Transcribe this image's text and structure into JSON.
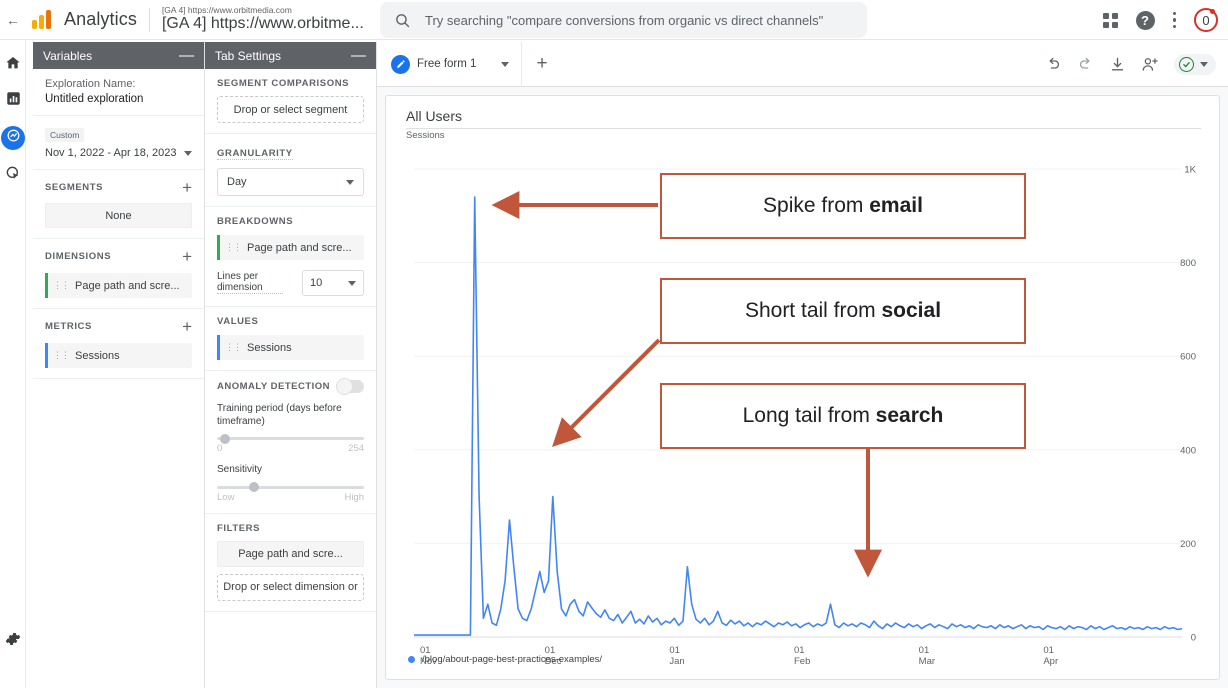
{
  "header": {
    "back_icon": "back-arrow-icon",
    "brand": "Analytics",
    "property_sub": "[GA 4] https://www.orbitmedia.com",
    "property_main": "[GA 4] https://www.orbitme...",
    "search_placeholder": "Try searching \"compare conversions from organic vs direct channels\"",
    "search_value": "",
    "apps_icon": "apps-grid-icon",
    "help_icon": "help-icon",
    "more_icon": "more-vertical-icon",
    "avatar_label": "0"
  },
  "rail": {
    "items": [
      {
        "name": "home-icon",
        "label": "Home"
      },
      {
        "name": "reports-icon",
        "label": "Reports"
      },
      {
        "name": "explore-icon",
        "label": "Explore"
      },
      {
        "name": "advertising-icon",
        "label": "Advertising"
      }
    ],
    "settings": {
      "name": "gear-icon",
      "label": "Admin"
    }
  },
  "variables": {
    "title": "Variables",
    "collapse": "—",
    "exploration_label": "Exploration Name:",
    "exploration_value": "Untitled exploration",
    "date_chip": "Custom",
    "date_range": "Nov 1, 2022 - Apr 18, 2023",
    "segments_label": "SEGMENTS",
    "segments_value": "None",
    "dimensions_label": "DIMENSIONS",
    "dimensions_value": "Page path and scre...",
    "metrics_label": "METRICS",
    "metrics_value": "Sessions",
    "add_label": "+"
  },
  "tab_settings": {
    "title": "Tab Settings",
    "collapse": "—",
    "segment_comparisons_label": "SEGMENT COMPARISONS",
    "segment_comparisons_value": "Drop or select segment",
    "granularity_label": "GRANULARITY",
    "granularity_value": "Day",
    "breakdowns_label": "BREAKDOWNS",
    "breakdowns_value": "Page path and scre...",
    "lines_per_label": "Lines per dimension",
    "lines_per_value": "10",
    "values_label": "VALUES",
    "values_value": "Sessions",
    "anomaly_label": "ANOMALY DETECTION",
    "anomaly_toggle": "off",
    "training_label": "Training period (days before timeframe)",
    "training_min": "0",
    "training_max": "254",
    "sensitivity_label": "Sensitivity",
    "sensitivity_min": "Low",
    "sensitivity_max": "High",
    "filters_label": "FILTERS",
    "filters_value": "Page path and scre...",
    "filters_drop": "Drop or select dimension or"
  },
  "canvas": {
    "tab_label": "Free form 1",
    "tab_icon": "pencil-icon",
    "tab_caret": "caret-down-icon",
    "add_tab": "+",
    "tools": [
      {
        "name": "undo-icon",
        "label": "Undo"
      },
      {
        "name": "redo-icon",
        "label": "Redo"
      },
      {
        "name": "download-icon",
        "label": "Download"
      },
      {
        "name": "share-add-user-icon",
        "label": "Share"
      }
    ],
    "status_icon": "check-circle-icon",
    "status_caret": "caret-down-icon"
  },
  "chart_data": {
    "type": "line",
    "title": "All Users",
    "subtitle": "Sessions",
    "xlabel": "",
    "ylabel": "Sessions",
    "ylim": [
      0,
      1000
    ],
    "y_ticks": [
      "0",
      "200",
      "400",
      "600",
      "800",
      "1K"
    ],
    "y_tick_values": [
      0,
      200,
      400,
      600,
      800,
      1000
    ],
    "x_ticks": [
      {
        "day": "01",
        "month": "Nov"
      },
      {
        "day": "01",
        "month": "Dec"
      },
      {
        "day": "01",
        "month": "Jan"
      },
      {
        "day": "01",
        "month": "Feb"
      },
      {
        "day": "01",
        "month": "Mar"
      },
      {
        "day": "01",
        "month": "Apr"
      }
    ],
    "grid": true,
    "legend_position": "bottom-left",
    "series": [
      {
        "name": "/blog/about-page-best-practices-examples/",
        "color": "#4285f4",
        "values": [
          4,
          4,
          4,
          4,
          4,
          4,
          4,
          4,
          4,
          4,
          4,
          4,
          4,
          4,
          940,
          300,
          40,
          70,
          30,
          25,
          60,
          120,
          250,
          150,
          60,
          40,
          35,
          60,
          100,
          140,
          95,
          120,
          300,
          140,
          60,
          45,
          70,
          80,
          55,
          45,
          75,
          62,
          50,
          42,
          58,
          40,
          35,
          48,
          30,
          42,
          55,
          30,
          38,
          28,
          45,
          32,
          40,
          26,
          34,
          30,
          40,
          25,
          34,
          150,
          70,
          38,
          30,
          40,
          26,
          34,
          55,
          30,
          25,
          36,
          28,
          34,
          24,
          30,
          22,
          30,
          26,
          34,
          28,
          22,
          30,
          26,
          32,
          24,
          28,
          20,
          26,
          30,
          22,
          28,
          24,
          30,
          70,
          26,
          20,
          30,
          24,
          28,
          22,
          30,
          26,
          20,
          34,
          24,
          18,
          28,
          22,
          30,
          24,
          20,
          28,
          22,
          26,
          18,
          24,
          28,
          20,
          26,
          22,
          18,
          28,
          22,
          26,
          20,
          24,
          18,
          26,
          22,
          20,
          24,
          18,
          26,
          20,
          24,
          18,
          22,
          26,
          18,
          24,
          20,
          22,
          16,
          24,
          20,
          18,
          22,
          16,
          24,
          18,
          22,
          20,
          16,
          24,
          18,
          22,
          16,
          20,
          24,
          18,
          20,
          16,
          22,
          18,
          20,
          16,
          22,
          18,
          20,
          16,
          22,
          18,
          20,
          16,
          18
        ]
      }
    ]
  },
  "annotations": [
    {
      "prefix": "Spike from ",
      "bold": "email"
    },
    {
      "prefix": "Short tail from ",
      "bold": "social"
    },
    {
      "prefix": "Long tail from ",
      "bold": "search"
    }
  ],
  "colors": {
    "accent": "#1a73e8",
    "line": "#4285f4",
    "annotation": "#c0563a",
    "brand_orange": "#f9ab00"
  }
}
